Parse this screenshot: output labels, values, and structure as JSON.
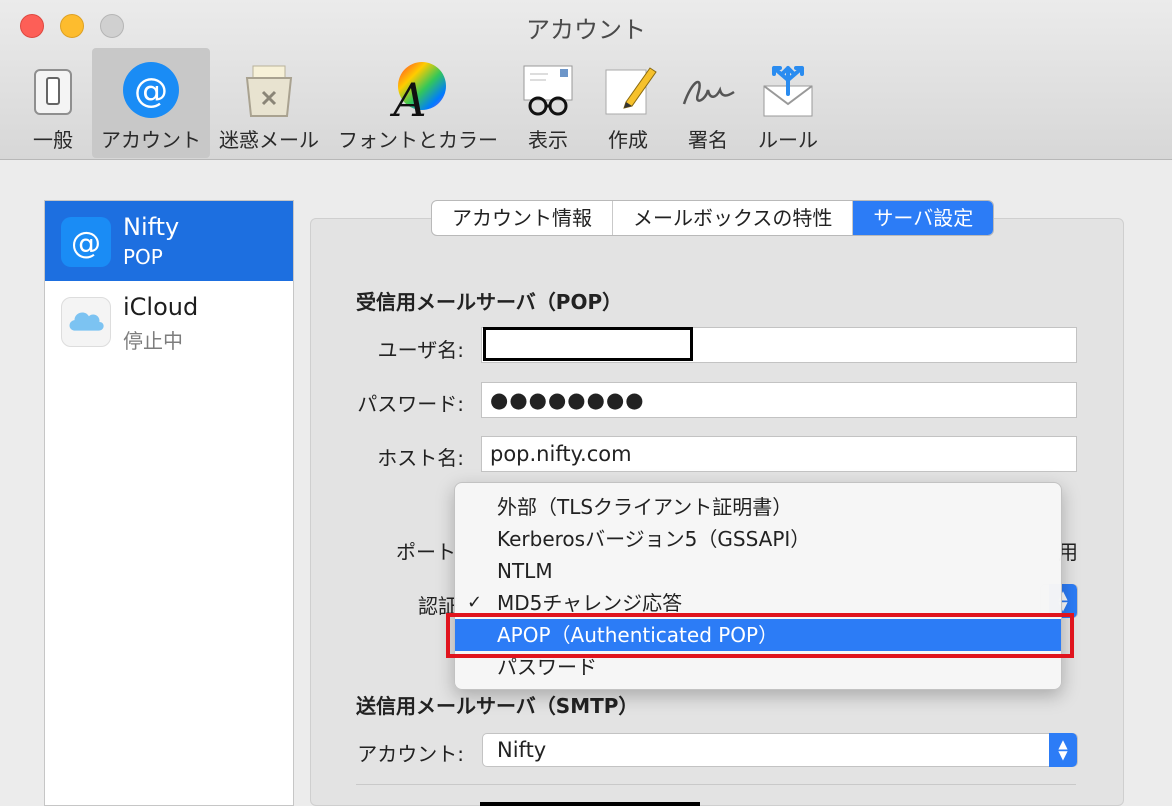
{
  "window": {
    "title": "アカウント"
  },
  "toolbar": {
    "items": [
      {
        "label": "一般",
        "icon": "switch-icon"
      },
      {
        "label": "アカウント",
        "icon": "at-icon"
      },
      {
        "label": "迷惑メール",
        "icon": "junk-bin-icon"
      },
      {
        "label": "フォントとカラー",
        "icon": "font-color-icon"
      },
      {
        "label": "表示",
        "icon": "view-glasses-icon"
      },
      {
        "label": "作成",
        "icon": "compose-pencil-icon"
      },
      {
        "label": "署名",
        "icon": "signature-icon"
      },
      {
        "label": "ルール",
        "icon": "rules-envelope-icon"
      }
    ]
  },
  "accounts": [
    {
      "name": "Nifty",
      "status": "POP"
    },
    {
      "name": "iCloud",
      "status": "停止中"
    }
  ],
  "tabs": [
    {
      "label": "アカウント情報"
    },
    {
      "label": "メールボックスの特性"
    },
    {
      "label": "サーバ設定"
    }
  ],
  "incoming": {
    "heading": "受信用メールサーバ（POP）",
    "username_label": "ユーザ名:",
    "username_value": "",
    "password_label": "パスワード:",
    "password_value": "●●●●●●●●",
    "host_label": "ホスト名:",
    "host_value": "pop.nifty.com",
    "port_label": "ポート",
    "tls_partial": "用",
    "auth_label": "認証"
  },
  "auth_menu": {
    "items": [
      "外部（TLSクライアント証明書）",
      "Kerberosバージョン5（GSSAPI）",
      "NTLM",
      "MD5チャレンジ応答",
      "APOP（Authenticated POP）",
      "パスワード"
    ],
    "checked": "MD5チャレンジ応答",
    "highlighted": "APOP（Authenticated POP）"
  },
  "outgoing": {
    "heading": "送信用メールサーバ（SMTP）",
    "account_label": "アカウント:",
    "account_value": "Nifty"
  },
  "colors": {
    "accent": "#2c7cf6",
    "annotation": "#e0141e"
  }
}
